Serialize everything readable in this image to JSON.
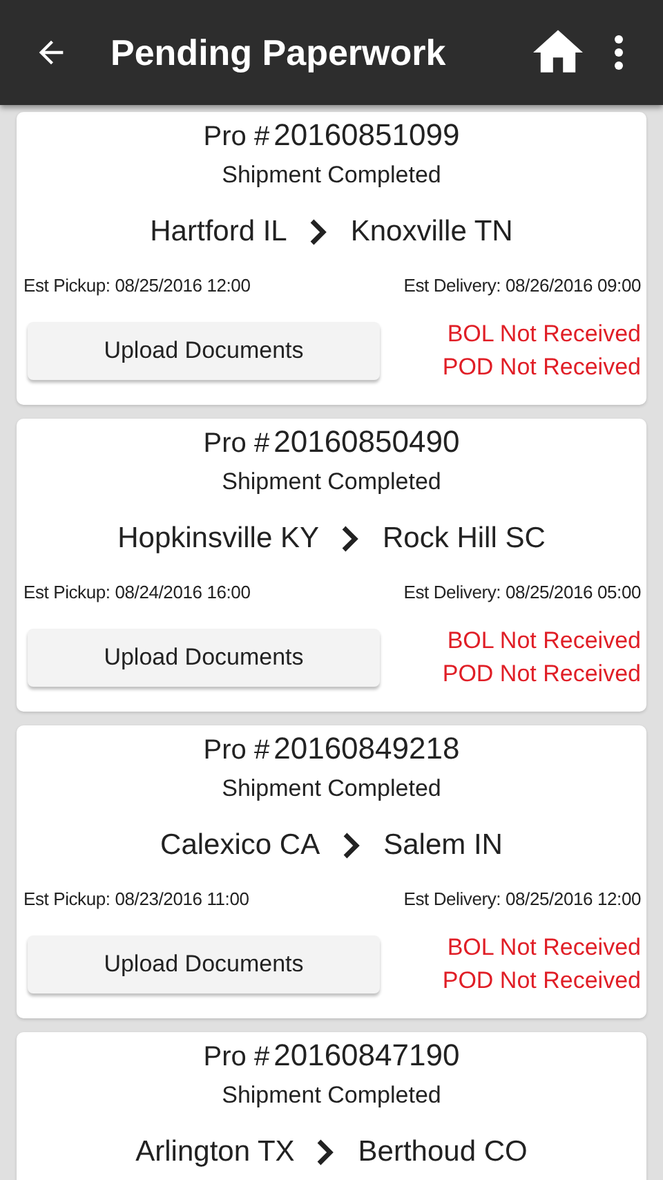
{
  "app_bar": {
    "title": "Pending Paperwork"
  },
  "shipments": [
    {
      "pro_label": "Pro #",
      "pro_number": "20160851099",
      "status": "Shipment Completed",
      "origin": "Hartford IL",
      "destination": "Knoxville TN",
      "pickup": "Est Pickup: 08/25/2016 12:00",
      "delivery": "Est Delivery: 08/26/2016 09:00",
      "button": "Upload Documents",
      "alerts": [
        "BOL Not Received",
        "POD Not Received"
      ]
    },
    {
      "pro_label": "Pro #",
      "pro_number": "20160850490",
      "status": "Shipment Completed",
      "origin": "Hopkinsville KY",
      "destination": "Rock Hill SC",
      "pickup": "Est Pickup: 08/24/2016 16:00",
      "delivery": "Est Delivery: 08/25/2016 05:00",
      "button": "Upload Documents",
      "alerts": [
        "BOL Not Received",
        "POD Not Received"
      ]
    },
    {
      "pro_label": "Pro #",
      "pro_number": "20160849218",
      "status": "Shipment Completed",
      "origin": "Calexico CA",
      "destination": "Salem IN",
      "pickup": "Est Pickup: 08/23/2016 11:00",
      "delivery": "Est Delivery: 08/25/2016 12:00",
      "button": "Upload Documents",
      "alerts": [
        "BOL Not Received",
        "POD Not Received"
      ]
    },
    {
      "pro_label": "Pro #",
      "pro_number": "20160847190",
      "status": "Shipment Completed",
      "origin": "Arlington TX",
      "destination": "Berthoud CO"
    }
  ]
}
